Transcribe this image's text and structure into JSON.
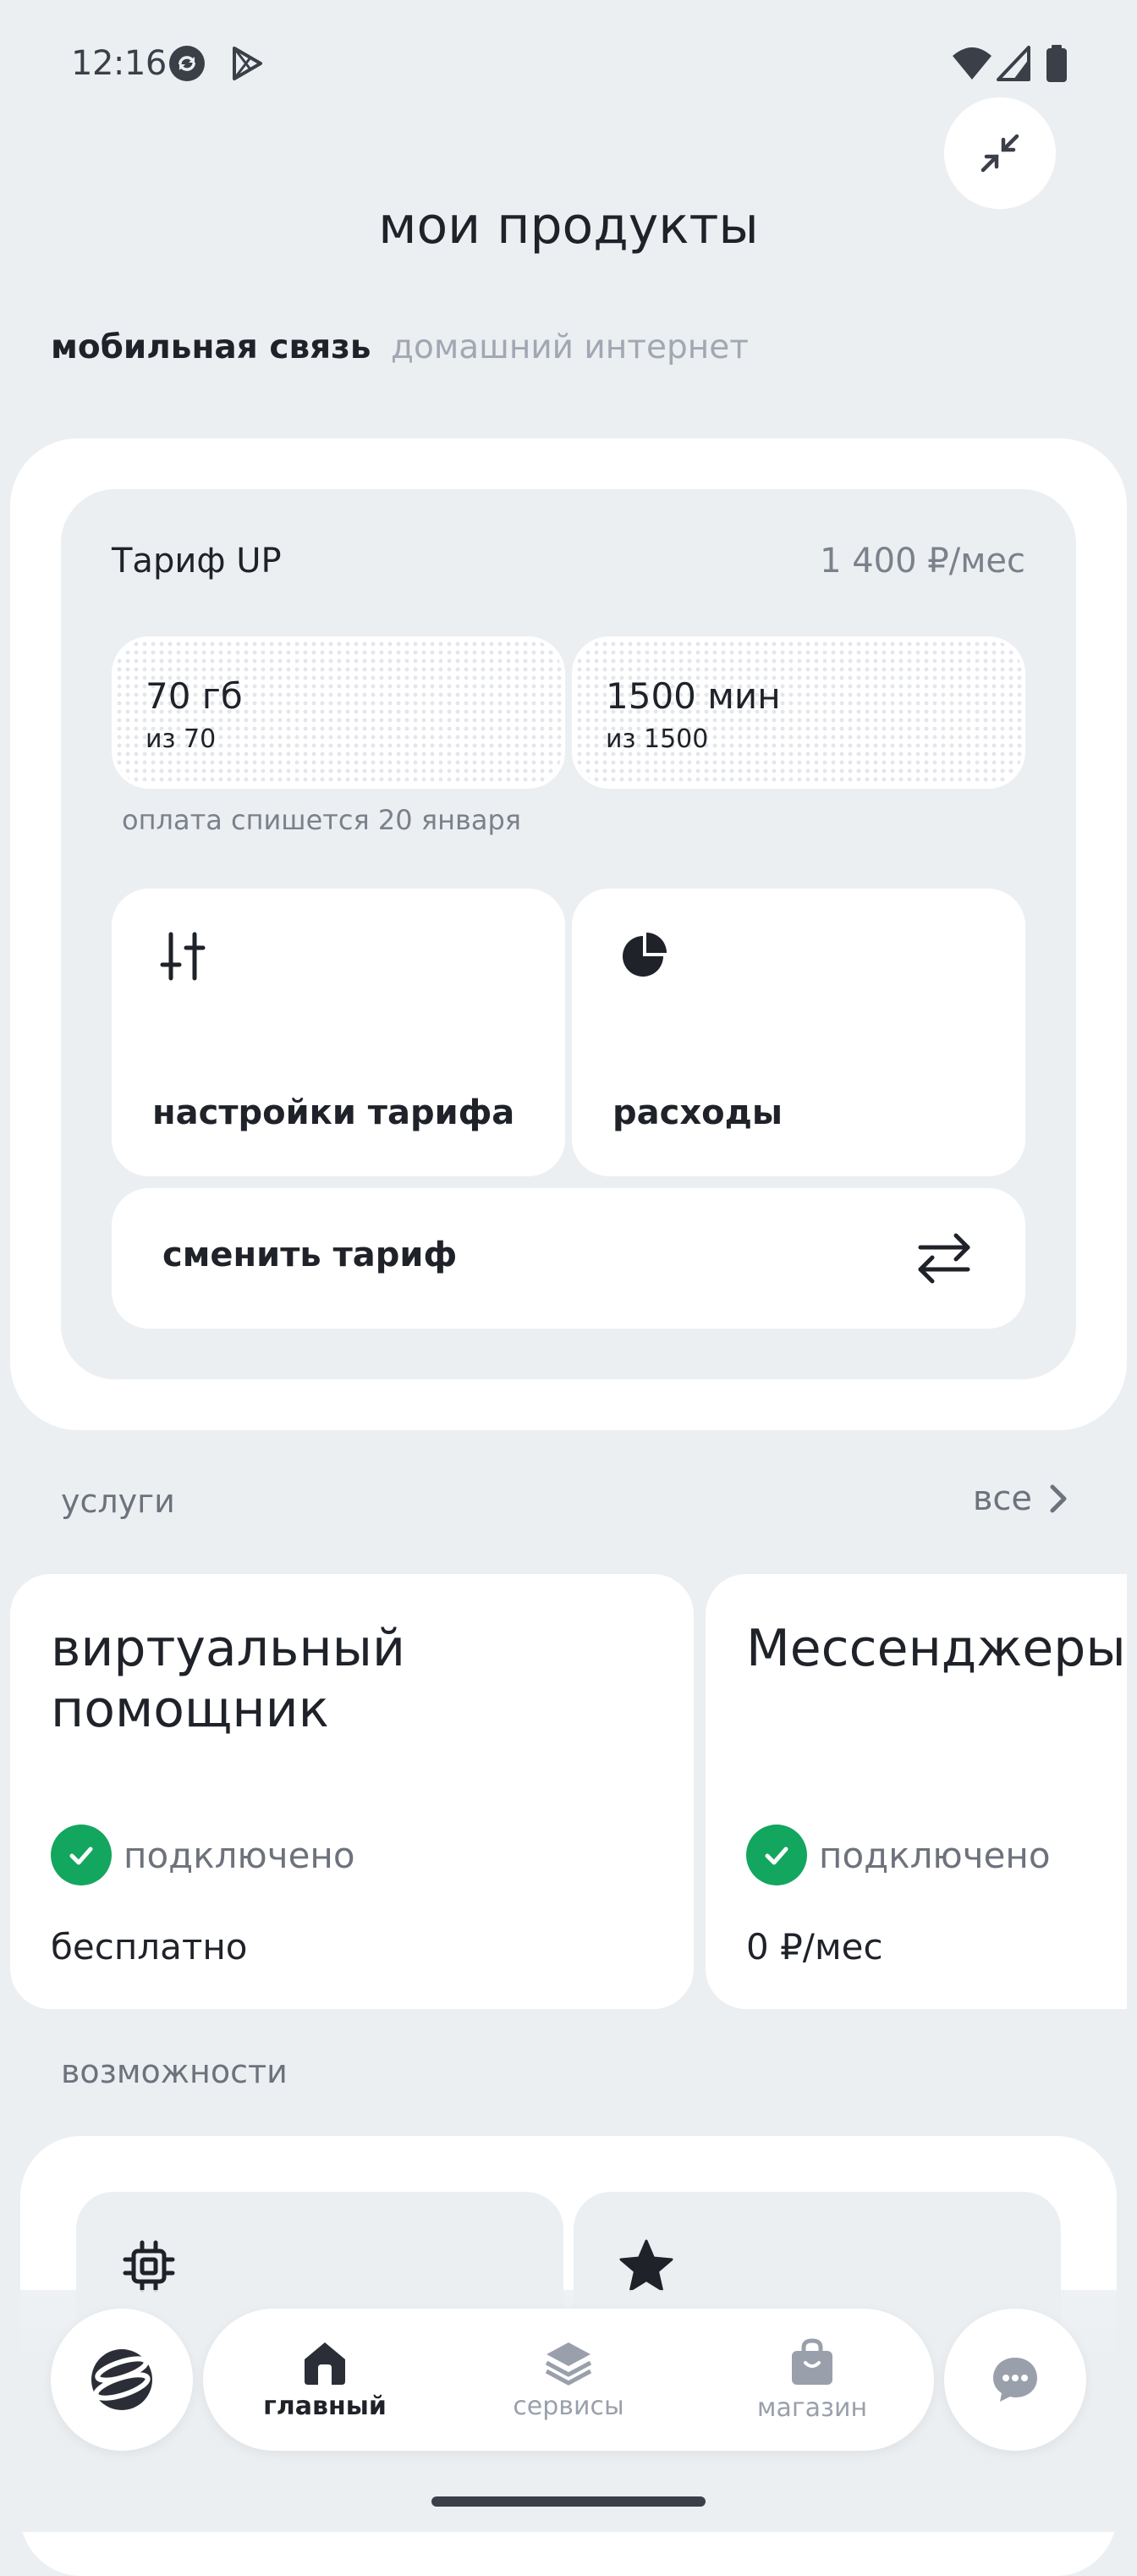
{
  "status_bar": {
    "time": "12:16",
    "left_icons": [
      "sync-icon",
      "play-icon"
    ],
    "right_icons": [
      "wifi-icon",
      "signal-icon",
      "battery-icon"
    ]
  },
  "header": {
    "title": "мои продукты",
    "collapse_icon": "collapse-icon"
  },
  "tabs": [
    {
      "label": "мобильная связь",
      "active": true
    },
    {
      "label": "домашний интернет",
      "active": false
    }
  ],
  "tariff": {
    "name": "Тариф UP",
    "price": "1 400 ₽/мес",
    "quotas": [
      {
        "value": "70 гб",
        "of": "из 70"
      },
      {
        "value": "1500 мин",
        "of": "из 1500"
      }
    ],
    "payment_note": "оплата спишется 20 января",
    "actions": [
      {
        "label": "настройки тарифа",
        "icon": "sliders-icon"
      },
      {
        "label": "расходы",
        "icon": "pie-chart-icon"
      }
    ],
    "change": {
      "label": "сменить тариф",
      "icon": "swap-icon"
    }
  },
  "services": {
    "title": "услуги",
    "see_all": "все",
    "items": [
      {
        "title_line1": "виртуальный",
        "title_line2": "помощник",
        "status": "подключено",
        "price": "бесплатно"
      },
      {
        "title_line1": "Мессенджеры",
        "title_line2": "",
        "status": "подключено",
        "price": "0 ₽/мес"
      }
    ]
  },
  "features": {
    "title": "возможности",
    "tiles": [
      {
        "icon": "chip-icon"
      },
      {
        "icon": "star-icon"
      }
    ]
  },
  "bottom_nav": {
    "logo_icon": "brand-logo-icon",
    "items": [
      {
        "label": "главный",
        "icon": "home-icon",
        "active": true
      },
      {
        "label": "сервисы",
        "icon": "layers-icon",
        "active": false
      },
      {
        "label": "магазин",
        "icon": "shopping-bag-icon",
        "active": false
      }
    ],
    "chat_icon": "chat-icon"
  },
  "colors": {
    "background": "#eceff2",
    "card": "#ffffff",
    "text_primary": "#1f2229",
    "text_secondary": "#6d727c",
    "success": "#13a65e"
  }
}
